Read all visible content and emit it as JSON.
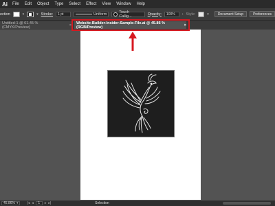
{
  "app": {
    "logo": "Ai",
    "menu": [
      "File",
      "Edit",
      "Object",
      "Type",
      "Select",
      "Effect",
      "View",
      "Window",
      "Help"
    ]
  },
  "control_bar": {
    "selection_label": "ection",
    "stroke_label": "Stroke:",
    "stroke_weight": "1 pt",
    "stroke_profile": "Uniform",
    "brush_name": "Touch Callig...",
    "opacity_label": "Opacity:",
    "opacity_value": "100%",
    "style_label": "Style:",
    "document_setup_label": "Document Setup",
    "preferences_label": "Preferences"
  },
  "tabs": {
    "inactive_title": "Untitled-1 @ 61.45 % (CMYK/Preview)",
    "active_title": "Website-Builder-Insider-Sample-File.ai @ 45.86 % (RGB/Preview)",
    "close_glyph": "×"
  },
  "status_bar": {
    "zoom": "45.86%",
    "page": "1",
    "status_text": "Selection"
  },
  "colors": {
    "highlight": "#d71920",
    "artwork_bg": "#1e1e1e",
    "artboard": "#ffffff"
  },
  "icons": [
    "illustrator-logo-icon",
    "fill-swatch-icon",
    "stroke-swatch-icon",
    "phoenix-artwork",
    "red-arrow-icon",
    "close-icon"
  ]
}
